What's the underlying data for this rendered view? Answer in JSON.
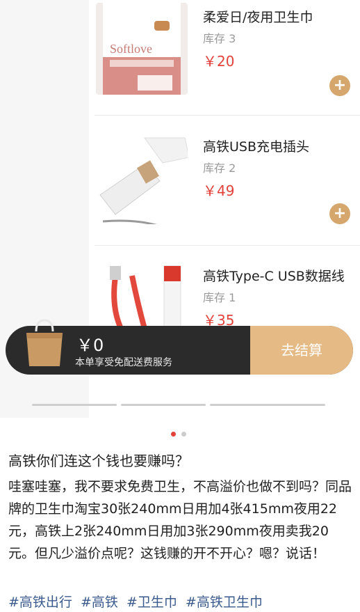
{
  "products": [
    {
      "name": "柔爱日/夜用卫生巾",
      "stock": "库存 3",
      "price": "￥20",
      "brand_text": "Softlove"
    },
    {
      "name": "高铁USB充电插头",
      "stock": "库存 2",
      "price": "￥49"
    },
    {
      "name": "高铁Type-C USB数据线",
      "stock": "库存 1",
      "price": "￥35"
    }
  ],
  "cart": {
    "total": "￥0",
    "delivery_note": "本单享受免配送费服务",
    "checkout_label": "去结算"
  },
  "post": {
    "title": "高铁你们连这个钱也要赚吗？",
    "body": "哇塞哇塞，我不要求免费卫生，不高溢价也做不到吗？同品牌的卫生巾淘宝30张240mm日用加4张415mm夜用22元，高铁上2张240mm日用加3张290mm夜用卖我20元。但凡少溢价点呢？这钱赚的开不开心？嗯？说话！",
    "tags": [
      "#高铁出行",
      "#高铁",
      "#卫生巾",
      "#高铁卫生巾"
    ]
  },
  "colors": {
    "price": "#e3413a",
    "accent": "#d6a76c",
    "checkout": "#e6ba84",
    "tag": "#3a5a8c"
  },
  "carousel": {
    "current_page": 1,
    "total_pages": 2
  }
}
